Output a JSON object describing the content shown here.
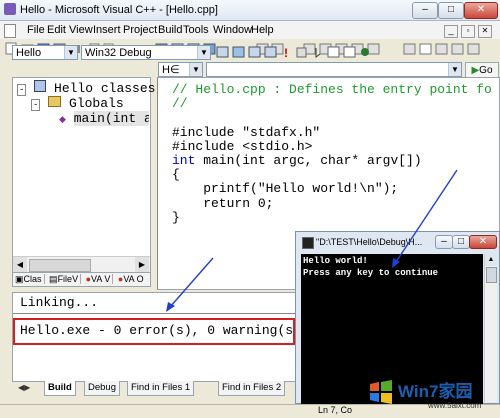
{
  "window": {
    "title": "Hello - Microsoft Visual C++ - [Hello.cpp]",
    "min": "–",
    "max": "□",
    "close": "✕"
  },
  "menu": [
    "File",
    "Edit",
    "View",
    "Insert",
    "Project",
    "Build",
    "Tools",
    "Window",
    "Help"
  ],
  "toolbar": {
    "project_combo": "Hello",
    "config_combo": "Win32 Debug",
    "editor_combo": "H∈",
    "go_label": "Go"
  },
  "classview": {
    "root": "Hello classes",
    "globals": "Globals",
    "main": "main(int a",
    "tabs": [
      "Clas",
      "FileV",
      "VA V",
      "VA O"
    ]
  },
  "editor": {
    "lines": [
      {
        "text": "// Hello.cpp : Defines the entry point fo",
        "kind": "comment"
      },
      {
        "text": "//",
        "kind": "comment"
      },
      {
        "text": "",
        "kind": "code"
      },
      {
        "text": "#include \"stdafx.h\"",
        "kind": "code"
      },
      {
        "text": "#include <stdio.h>",
        "kind": "code"
      },
      {
        "text": "int main(int argc, char* argv[])",
        "kind": "code"
      },
      {
        "text": "{",
        "kind": "code"
      },
      {
        "text": "    printf(\"Hello world!\\n\");",
        "kind": "code"
      },
      {
        "text": "    return 0;",
        "kind": "code"
      },
      {
        "text": "}",
        "kind": "code"
      }
    ]
  },
  "output": {
    "line1": "Linking...",
    "line2": "Hello.exe - 0 error(s), 0 warning(s)",
    "tabs": [
      "Build",
      "Debug",
      "Find in Files 1",
      "Find in Files 2"
    ]
  },
  "status": "Ln 7, Co",
  "console": {
    "title": "\"D:\\TEST\\Hello\\Debug\\H...",
    "line1": "Hello world!",
    "line2": "Press any key to continue"
  },
  "watermark": {
    "brand": "Win7家园",
    "url": "www.5aixt.com"
  }
}
